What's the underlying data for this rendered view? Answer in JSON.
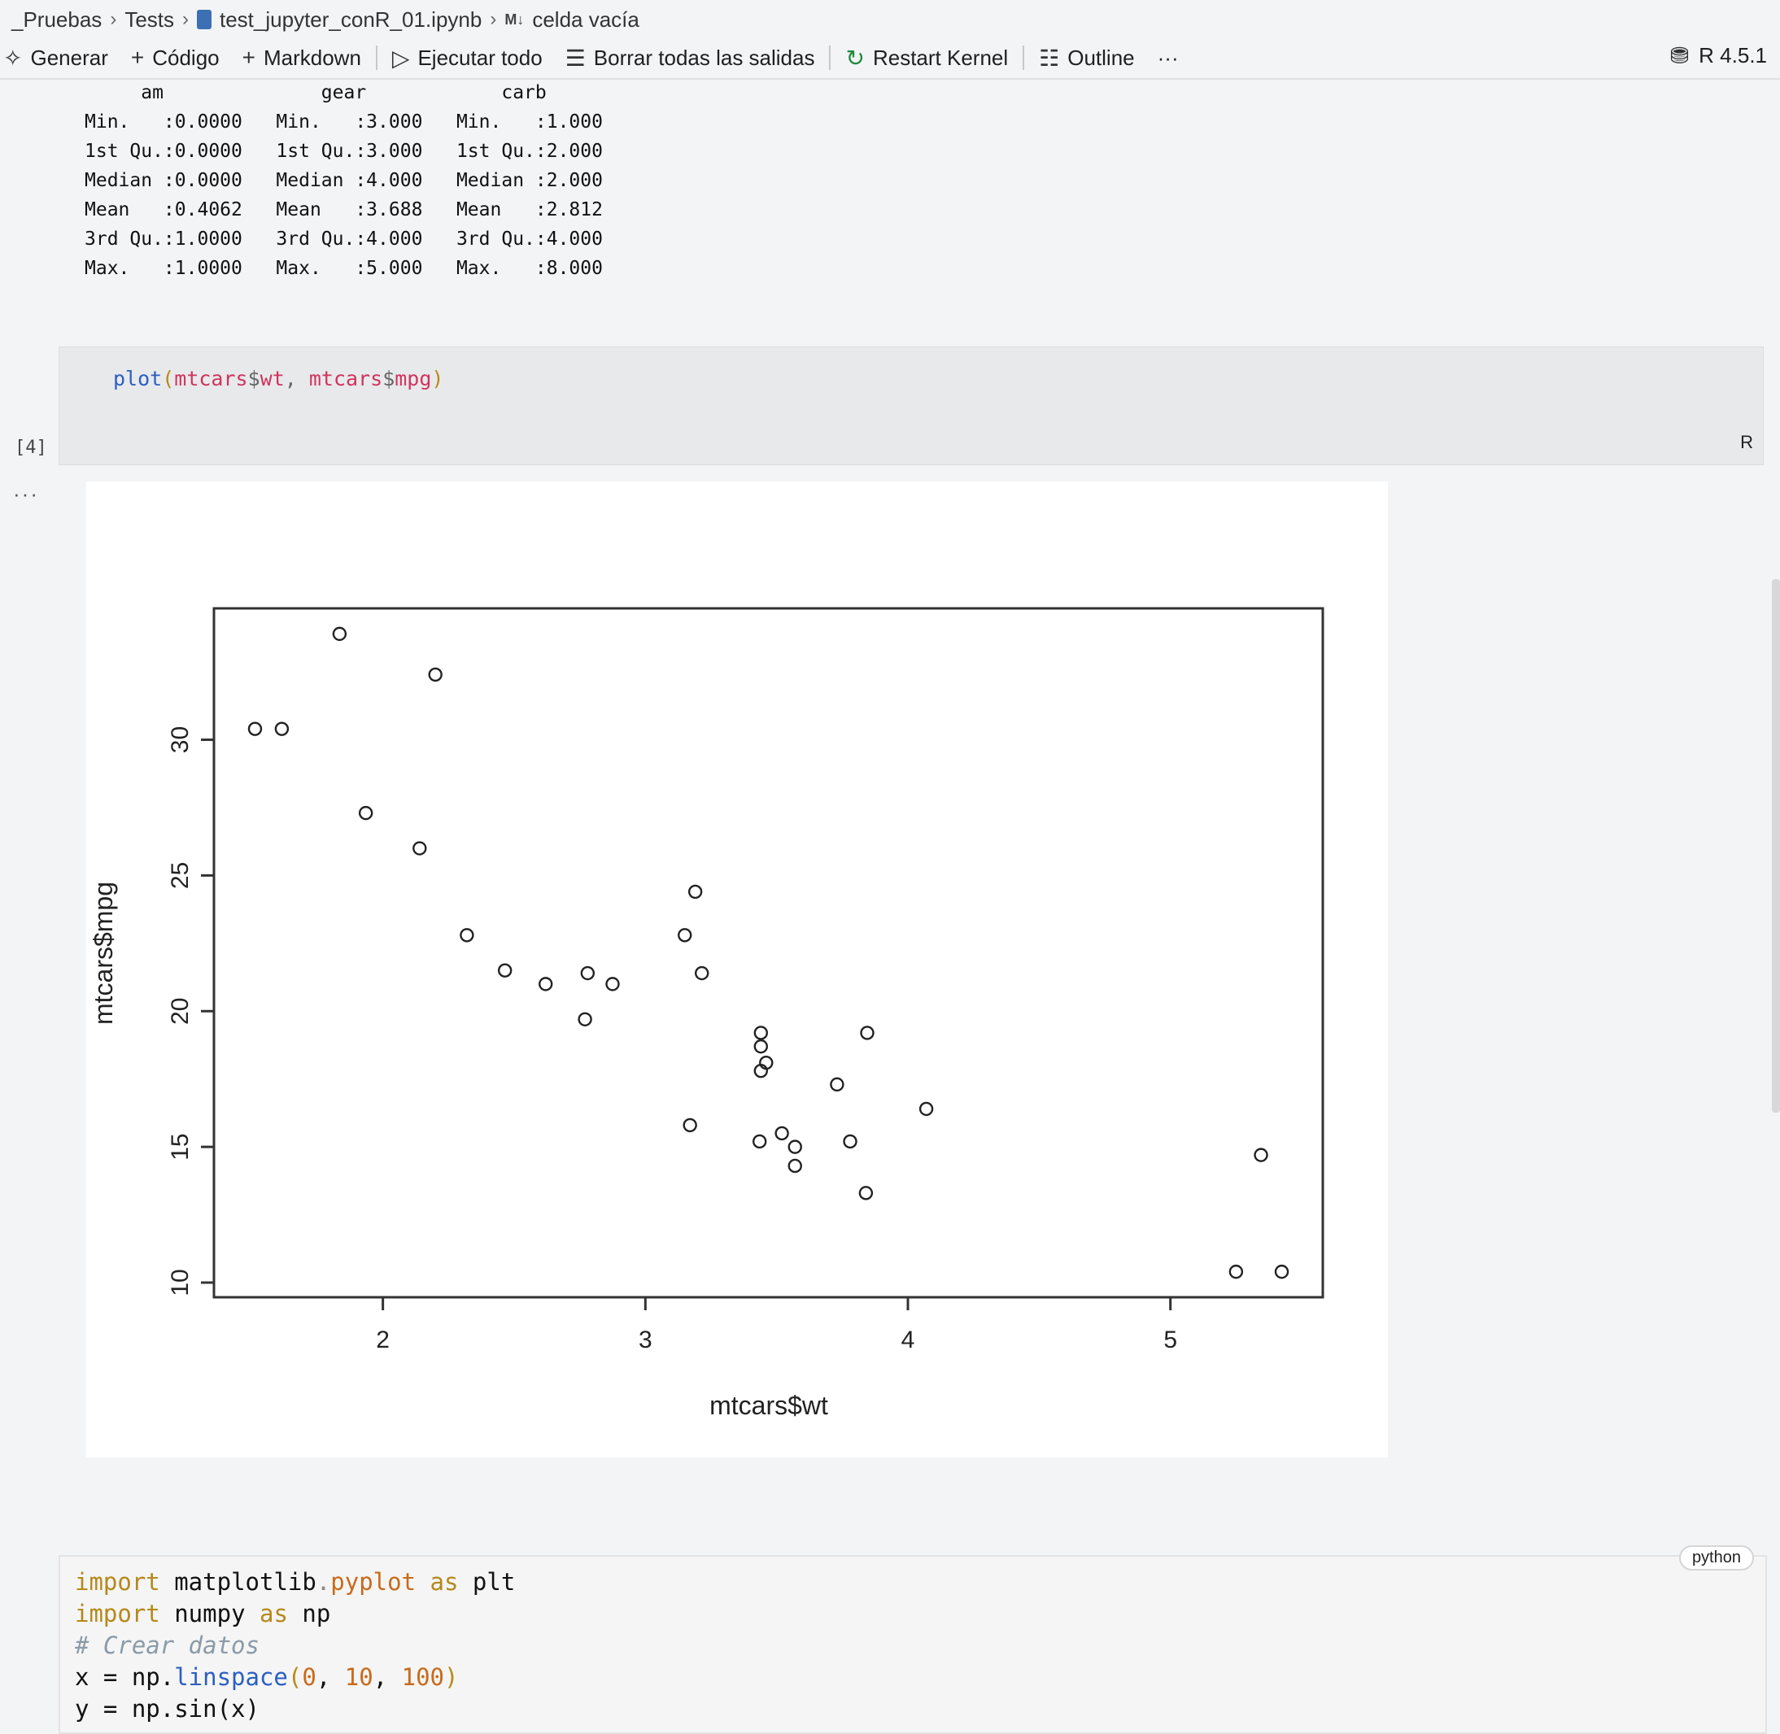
{
  "breadcrumb": {
    "items": [
      "_Pruebas",
      "Tests",
      "test_jupyter_conR_01.ipynb",
      "celda vacía"
    ],
    "md_badge": "M↓"
  },
  "toolbar": {
    "generate": "Generar",
    "add_code": "Código",
    "add_markdown": "Markdown",
    "run_all": "Ejecutar todo",
    "clear_outputs": "Borrar todas las salidas",
    "restart_kernel": "Restart Kernel",
    "outline": "Outline",
    "more": "···",
    "kernel": "R 4.5.1"
  },
  "summary_output": {
    "header": "     am              gear            carb      ",
    "rows": [
      "Min.   :0.0000   Min.   :3.000   Min.   :1.000  ",
      "1st Qu.:0.0000   1st Qu.:3.000   1st Qu.:2.000  ",
      "Median :0.0000   Median :4.000   Median :2.000  ",
      "Mean   :0.4062   Mean   :3.688   Mean   :2.812  ",
      "3rd Qu.:1.0000   3rd Qu.:4.000   3rd Qu.:4.000  ",
      "Max.   :1.0000   Max.   :5.000   Max.   :8.000  "
    ]
  },
  "r_cell": {
    "fn": "plot",
    "open": "(",
    "a1": "mtcars",
    "d1": "$",
    "a1b": "wt",
    "comma": ", ",
    "a2": "mtcars",
    "d2": "$",
    "a2b": "mpg",
    "close": ")",
    "language": "R",
    "exec_count": "[4]",
    "output_menu": "···"
  },
  "chart_data": {
    "type": "scatter",
    "xlabel": "mtcars$wt",
    "ylabel": "mtcars$mpg",
    "xlim": [
      1.513,
      5.424
    ],
    "ylim": [
      10.4,
      33.9
    ],
    "xticks": [
      2,
      3,
      4,
      5
    ],
    "yticks": [
      10,
      15,
      20,
      25,
      30
    ],
    "points": [
      [
        2.62,
        21.0
      ],
      [
        2.875,
        21.0
      ],
      [
        2.32,
        22.8
      ],
      [
        3.215,
        21.4
      ],
      [
        3.44,
        18.7
      ],
      [
        3.46,
        18.1
      ],
      [
        3.57,
        14.3
      ],
      [
        3.19,
        24.4
      ],
      [
        3.15,
        22.8
      ],
      [
        3.44,
        19.2
      ],
      [
        3.44,
        17.8
      ],
      [
        4.07,
        16.4
      ],
      [
        3.73,
        17.3
      ],
      [
        3.78,
        15.2
      ],
      [
        5.25,
        10.4
      ],
      [
        5.424,
        10.4
      ],
      [
        5.345,
        14.7
      ],
      [
        2.2,
        32.4
      ],
      [
        1.615,
        30.4
      ],
      [
        1.835,
        33.9
      ],
      [
        2.465,
        21.5
      ],
      [
        3.52,
        15.5
      ],
      [
        3.435,
        15.2
      ],
      [
        3.84,
        13.3
      ],
      [
        3.845,
        19.2
      ],
      [
        1.935,
        27.3
      ],
      [
        2.14,
        26.0
      ],
      [
        1.513,
        30.4
      ],
      [
        3.17,
        15.8
      ],
      [
        2.77,
        19.7
      ],
      [
        3.57,
        15.0
      ],
      [
        2.78,
        21.4
      ]
    ]
  },
  "py_cell": {
    "language": "python",
    "line1": {
      "kw1": "import",
      "mod": " matplotlib",
      "dot": ".",
      "sub": "pyplot",
      "kw2": " as",
      "alias": " plt"
    },
    "line2": {
      "kw1": "import",
      "mod": " numpy",
      "kw2": " as",
      "alias": " np"
    },
    "line3": "# Crear datos",
    "line4": {
      "lhs": "x = np.",
      "meth": "linspace",
      "open": "(",
      "n1": "0",
      "c1": ", ",
      "n2": "10",
      "c2": ", ",
      "n3": "100",
      "close": ")"
    },
    "line5": "y = np.sin(x)"
  }
}
